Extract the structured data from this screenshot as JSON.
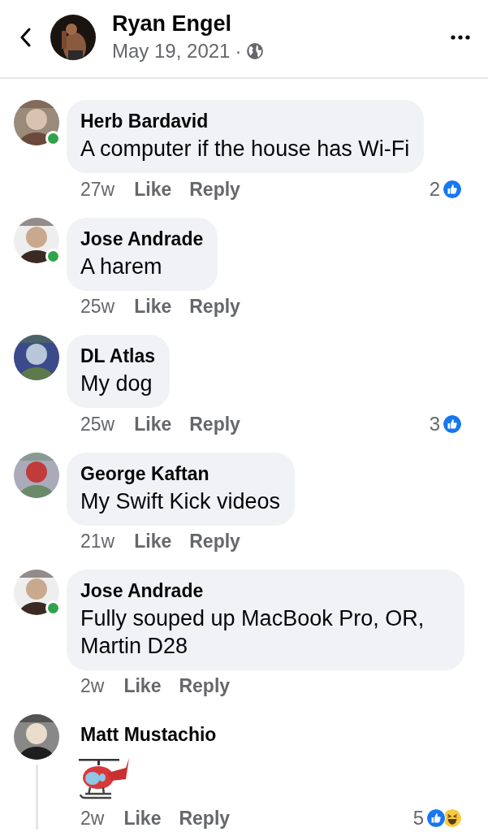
{
  "header": {
    "author": "Ryan Engel",
    "date": "May 19, 2021",
    "separator": "·"
  },
  "comments": [
    {
      "author": "Herb Bardavid",
      "online": true,
      "text": "A computer if the house has Wi-Fi",
      "time": "27w",
      "like": "Like",
      "reply": "Reply",
      "reactions": {
        "count": "2",
        "icons": [
          {
            "kind": "like"
          }
        ]
      }
    },
    {
      "author": "Jose Andrade",
      "online": true,
      "text": "A harem",
      "time": "25w",
      "like": "Like",
      "reply": "Reply"
    },
    {
      "author": "DL Atlas",
      "online": false,
      "text": "My dog",
      "time": "25w",
      "like": "Like",
      "reply": "Reply",
      "reactions": {
        "count": "3",
        "icons": [
          {
            "kind": "like"
          }
        ]
      }
    },
    {
      "author": "George Kaftan",
      "online": false,
      "text": "My Swift Kick videos",
      "time": "21w",
      "like": "Like",
      "reply": "Reply"
    },
    {
      "author": "Jose Andrade",
      "online": true,
      "text": "Fully souped up MacBook Pro, OR, Martin D28",
      "time": "2w",
      "like": "Like",
      "reply": "Reply"
    },
    {
      "author": "Matt Mustachio",
      "online": false,
      "kind": "sticker",
      "has_replies": true,
      "time": "2w",
      "like": "Like",
      "reply": "Reply",
      "reactions": {
        "count": "5",
        "icons": [
          {
            "kind": "like"
          },
          {
            "kind": "haha"
          }
        ]
      }
    }
  ]
}
